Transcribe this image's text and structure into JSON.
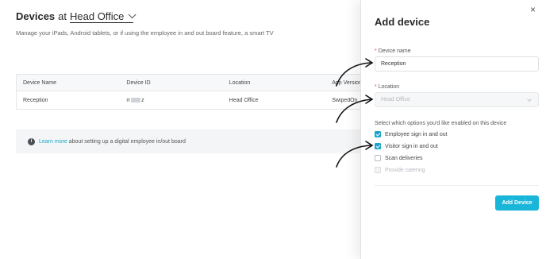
{
  "page": {
    "title": "Devices",
    "title_at": "at",
    "location": "Head Office",
    "subtitle": "Manage your iPads, Android tablets, or if using the employee in and out board feature, a smart TV"
  },
  "table": {
    "headers": [
      "Device Name",
      "Device ID",
      "Location",
      "App Version"
    ],
    "rows": [
      {
        "name": "Reception",
        "id_prefix": "rr",
        "id_suffix": "z",
        "location": "Head Office",
        "app_version": "SwipedOn"
      }
    ]
  },
  "info": {
    "link": "Learn more",
    "text": " about setting up a digital employee in/out board"
  },
  "drawer": {
    "title": "Add device",
    "close": "×",
    "device_name_label": "Device name",
    "device_name_value": "Reception",
    "location_label": "Location",
    "location_value": "Head Office",
    "options_label": "Select which options you'd like enabled on this device",
    "options": [
      {
        "label": "Employee sign in and out",
        "checked": true,
        "disabled": false
      },
      {
        "label": "Visitor sign in and out",
        "checked": true,
        "disabled": false
      },
      {
        "label": "Scan deliveries",
        "checked": false,
        "disabled": false
      },
      {
        "label": "Provide catering",
        "checked": false,
        "disabled": true
      }
    ],
    "submit": "Add Device"
  },
  "icons": {
    "info": "info-icon",
    "close": "close-icon",
    "chevron": "chevron-down-icon",
    "checkbox": "check-icon"
  },
  "colors": {
    "accent": "#1ab6d9",
    "link": "#1aa6c8",
    "required": "#e0524a"
  }
}
